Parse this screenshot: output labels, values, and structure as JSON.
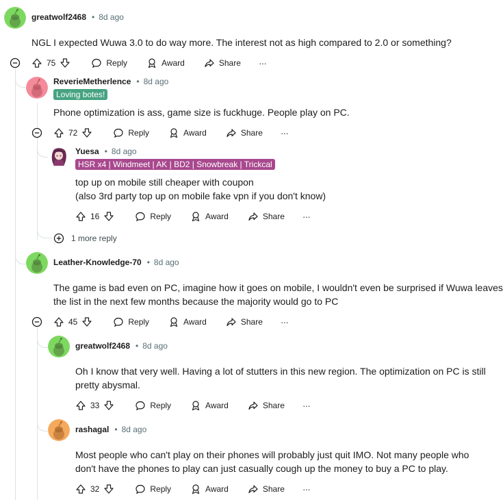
{
  "comments": [
    {
      "username": "greatwolf2468",
      "time": "8d ago",
      "avatar_color": "#7dd85f",
      "body": [
        "NGL I expected Wuwa 3.0 to do way more. The interest not as high compared to 2.0 or something?"
      ],
      "votes": "75"
    },
    {
      "username": "ReverieMetherlence",
      "time": "8d ago",
      "avatar_color": "#f48b9b",
      "flair": "Loving botes!",
      "flair_color": "#46a382",
      "body": [
        "Phone optimization is ass, game size is fuckhuge. People play on PC."
      ],
      "votes": "72"
    },
    {
      "username": "Yuesa",
      "time": "8d ago",
      "avatar_color": "#ffffff",
      "flair": "HSR x4 | Windmeet | AK | BD2 | Snowbreak | Trickcal",
      "flair_color": "#a8488e",
      "body": [
        "top up on mobile still cheaper with coupon",
        "(also 3rd party top up on mobile fake vpn if you don't know)"
      ],
      "votes": "16"
    },
    {
      "username": "Leather-Knowledge-70",
      "time": "8d ago",
      "avatar_color": "#7dd85f",
      "body": [
        "The game is bad even on PC, imagine how it goes on mobile, I wouldn't even be surprised if Wuwa leaves",
        "the list in the next few months because the majority would go to PC"
      ],
      "votes": "45"
    },
    {
      "username": "greatwolf2468",
      "time": "8d ago",
      "avatar_color": "#7dd85f",
      "body": [
        "Oh I know that very well. Having a lot of stutters in this new region. The optimization on PC is still",
        "pretty abysmal."
      ],
      "votes": "33"
    },
    {
      "username": "rashagal",
      "time": "8d ago",
      "avatar_color": "#f5a95c",
      "body": [
        "Most people who can't play on their phones will probably just quit IMO. Not many people who",
        "don't have the phones to play can just casually cough up the money to buy a PC to play."
      ],
      "votes": "32"
    }
  ],
  "labels": {
    "reply": "Reply",
    "award": "Award",
    "share": "Share",
    "more_options": "···",
    "more_replies": "1 more reply"
  },
  "icons": [
    "upvote-icon",
    "downvote-icon",
    "reply-icon",
    "award-icon",
    "share-icon",
    "more-options-icon",
    "collapse-icon",
    "expand-icon"
  ]
}
